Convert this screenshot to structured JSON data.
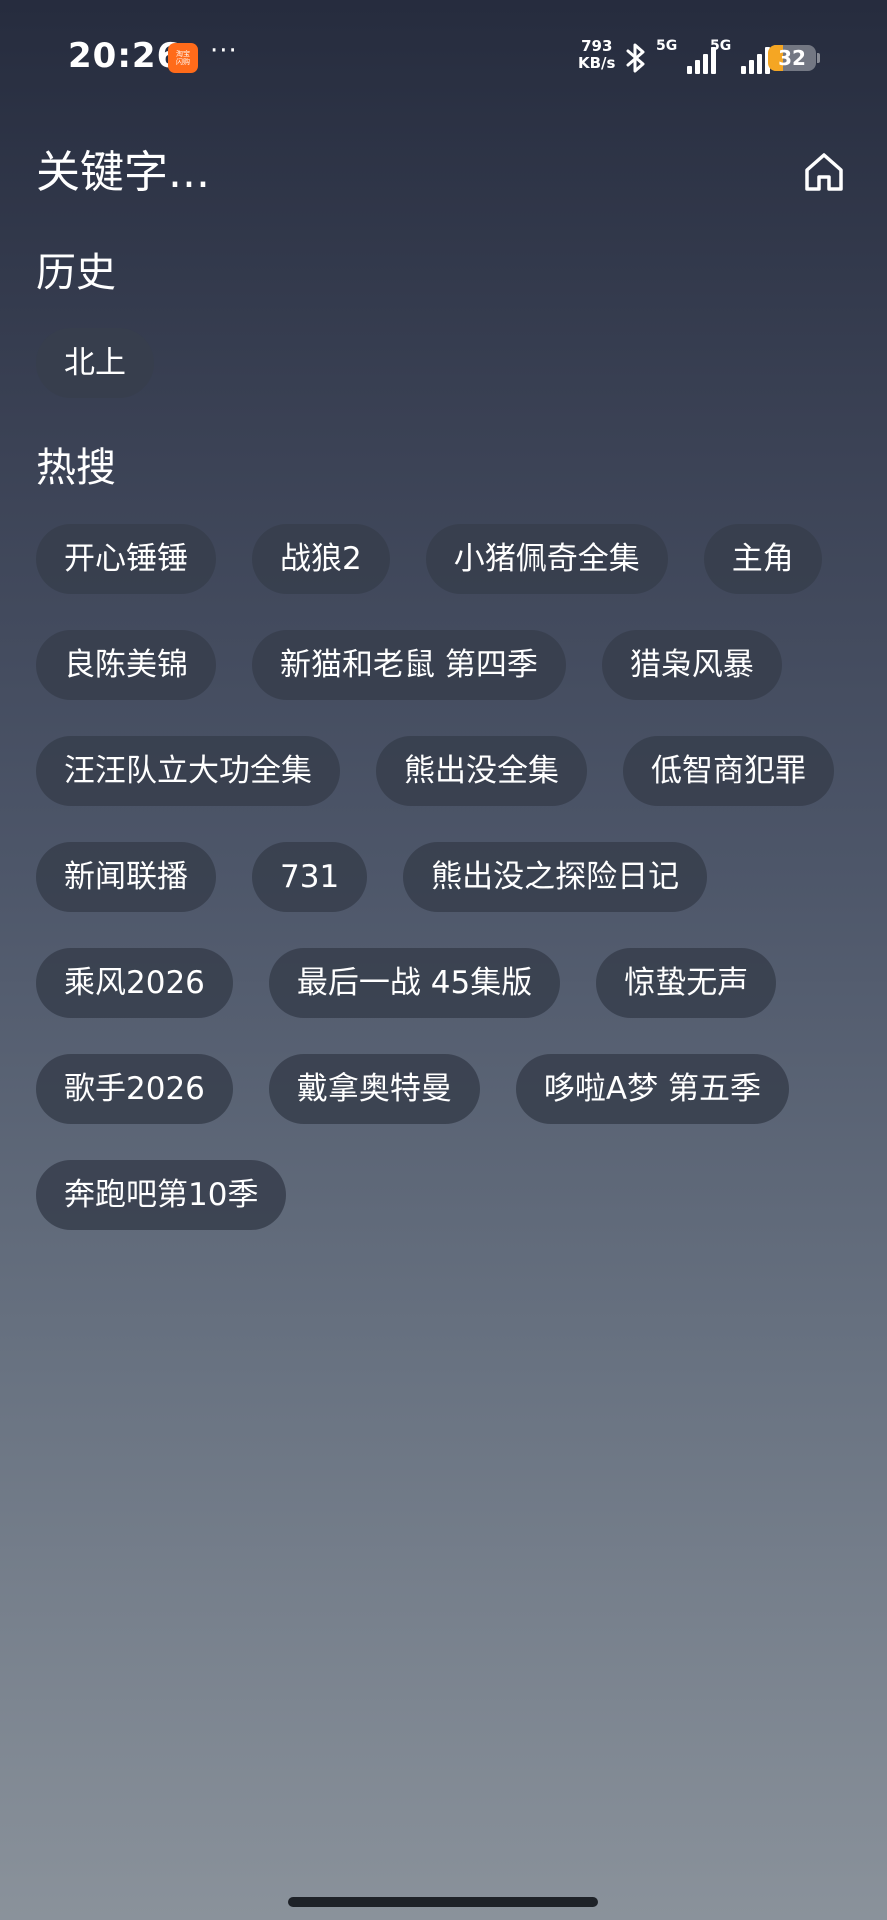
{
  "status_bar": {
    "time": "20:26",
    "app_badge_line1": "淘宝",
    "app_badge_line2": "闪购",
    "more_dots": "···",
    "net_speed_value": "793",
    "net_speed_unit": "KB/s",
    "sim1_label": "5G",
    "sim2_label": "5G",
    "battery_level": "32",
    "battery_fraction": 0.32,
    "icons": [
      "bluetooth-icon",
      "signal-icon",
      "battery-icon"
    ]
  },
  "search": {
    "placeholder": "关键字..."
  },
  "history": {
    "title": "历史",
    "items": [
      "北上"
    ]
  },
  "hot": {
    "title": "热搜",
    "items": [
      "开心锤锤",
      "战狼2",
      "小猪佩奇全集",
      "主角",
      "良陈美锦",
      "新猫和老鼠 第四季",
      "猎枭风暴",
      "汪汪队立大功全集",
      "熊出没全集",
      "低智商犯罪",
      "新闻联播",
      "731",
      "熊出没之探险日记",
      "乘风2026",
      "最后一战 45集版",
      "惊蛰无声",
      "歌手2026",
      "戴拿奥特曼",
      "哆啦A梦 第五季",
      "奔跑吧第10季"
    ]
  },
  "colors": {
    "chip_background": "#373e4c",
    "accent_battery": "#f5a623"
  }
}
